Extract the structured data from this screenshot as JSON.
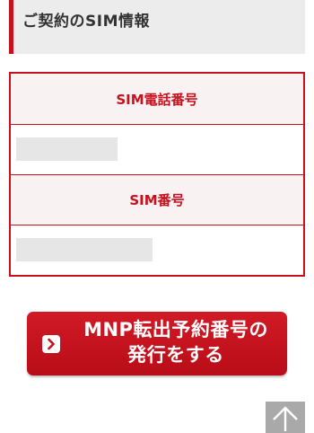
{
  "section": {
    "title": "ご契約のSIM情報"
  },
  "table": {
    "phone_label": "SIM電話番号",
    "sim_label": "SIM番号"
  },
  "mnp_button": {
    "line1": "MNP転出予約番号の",
    "line2": "発行をする",
    "icon": "chevron-right-icon"
  },
  "page_top": {
    "icon": "arrow-up-icon"
  },
  "colors": {
    "accent": "#c8101e",
    "header_bg": "#ececec",
    "label_bg": "#f8f2f2",
    "page_top_bg": "#a9a9a9"
  }
}
